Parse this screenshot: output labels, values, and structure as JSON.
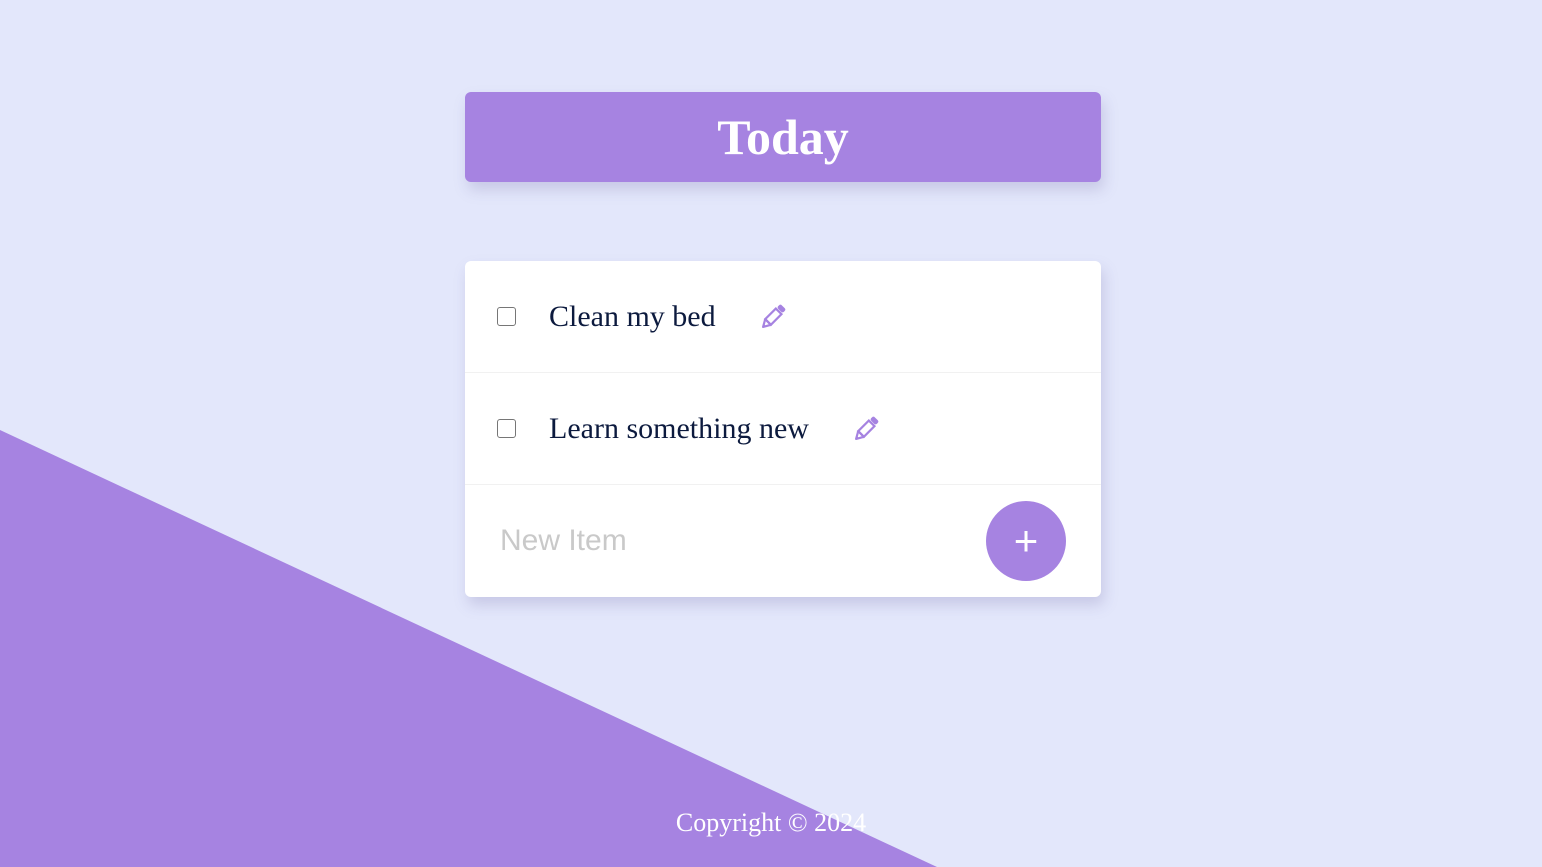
{
  "colors": {
    "background": "#E3E7FB",
    "accent": "#A683E1",
    "text": "#0C1A3E",
    "placeholder": "#C9C9C9"
  },
  "header": {
    "title": "Today"
  },
  "todo_list": {
    "items": [
      {
        "label": "Clean my bed",
        "checked": false,
        "edit_icon": "pencil-icon"
      },
      {
        "label": "Learn something new",
        "checked": false,
        "edit_icon": "pencil-icon"
      }
    ],
    "new_item": {
      "placeholder": "New Item",
      "value": ""
    },
    "add_button": {
      "label": "+",
      "icon": "plus-icon"
    }
  },
  "footer": {
    "copyright": "Copyright © 2024"
  }
}
